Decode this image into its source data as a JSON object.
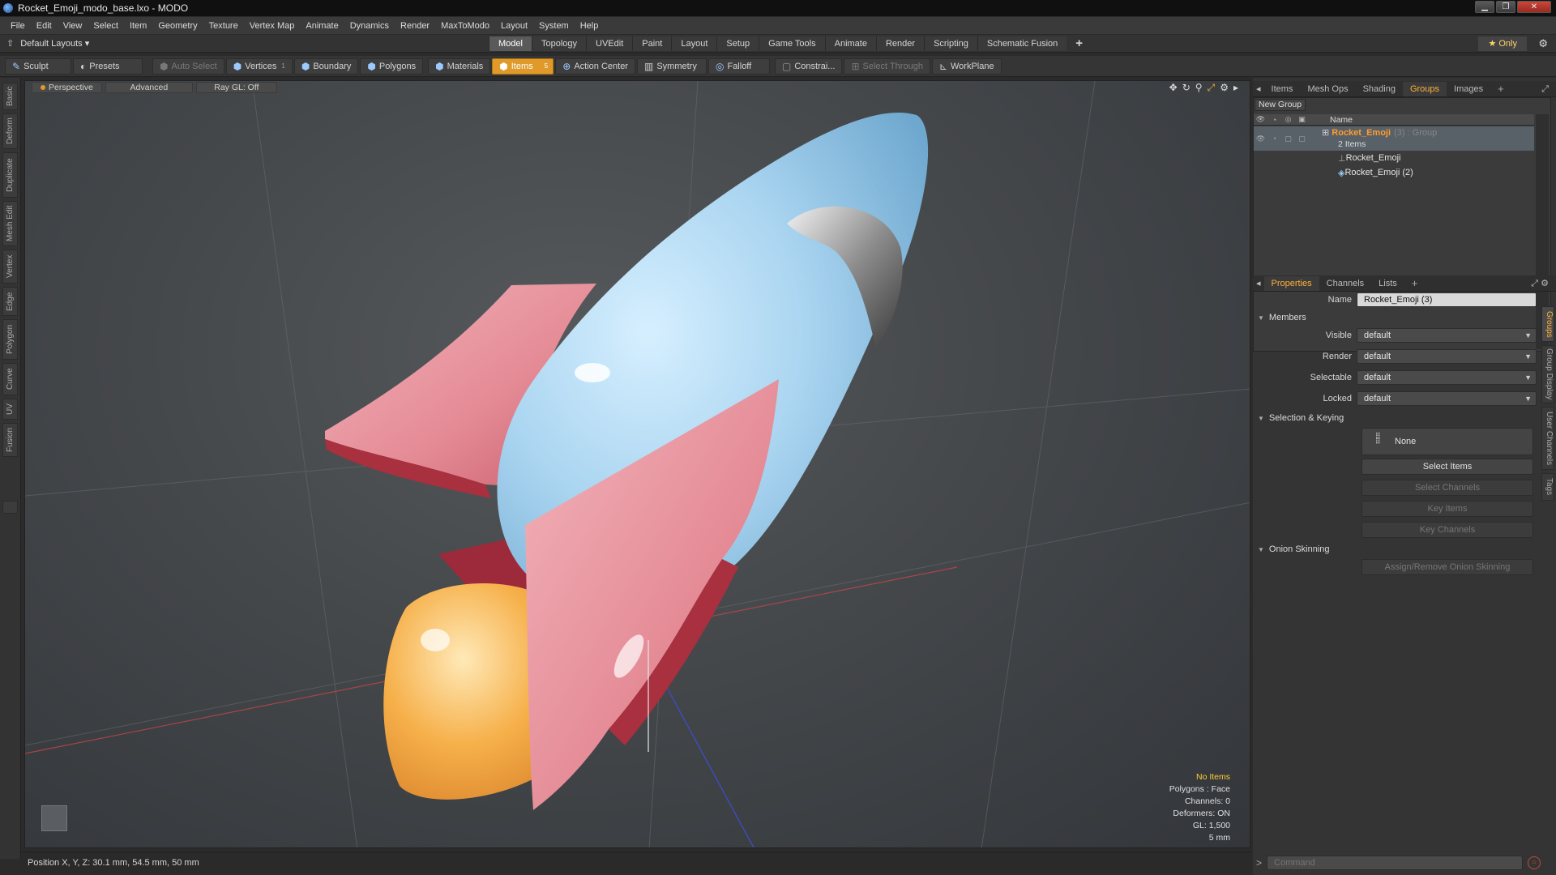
{
  "window": {
    "title": "Rocket_Emoji_modo_base.lxo - MODO",
    "minimize": "▁",
    "maximize": "❐",
    "close": "✕"
  },
  "menubar": [
    "File",
    "Edit",
    "View",
    "Select",
    "Item",
    "Geometry",
    "Texture",
    "Vertex Map",
    "Animate",
    "Dynamics",
    "Render",
    "MaxToModo",
    "Layout",
    "System",
    "Help"
  ],
  "layoutbar": {
    "layout_select": "Default Layouts ▾",
    "tabs": [
      "Model",
      "Topology",
      "UVEdit",
      "Paint",
      "Layout",
      "Setup",
      "Game Tools",
      "Animate",
      "Render",
      "Scripting",
      "Schematic Fusion"
    ],
    "active_tab": "Model",
    "plus": "+",
    "only": "★  Only"
  },
  "toolbar": {
    "sculpt": "Sculpt",
    "presets": "Presets",
    "auto_select": "Auto Select",
    "vertices": "Vertices",
    "vertices_count": "1",
    "boundary": "Boundary",
    "polygons": "Polygons",
    "materials": "Materials",
    "items": "Items",
    "items_count": "5",
    "action_center": "Action Center",
    "symmetry": "Symmetry",
    "falloff": "Falloff",
    "constrain": "Constrai...",
    "select_through": "Select Through",
    "workplane": "WorkPlane"
  },
  "left_tabs": [
    "Basic",
    "Deform",
    "Duplicate",
    "Mesh Edit",
    "Vertex",
    "Edge",
    "Polygon",
    "Curve",
    "UV",
    "Fusion"
  ],
  "viewport": {
    "view_mode": "Perspective",
    "advanced": "Advanced",
    "raygl": "Ray GL: Off",
    "info": {
      "no_items": "No Items",
      "polygons": "Polygons : Face",
      "channels": "Channels: 0",
      "deformers": "Deformers: ON",
      "gl": "GL: 1,500",
      "scale": "5 mm"
    }
  },
  "panel_tabs_top": [
    "Items",
    "Mesh Ops",
    "Shading",
    "Groups",
    "Images"
  ],
  "panel_tabs_top_active": "Groups",
  "groups": {
    "new_group": "New Group",
    "col_name": "Name",
    "group_name": "Rocket_Emoji",
    "group_suffix": "(3) : Group",
    "count": "2 Items",
    "members": [
      "Rocket_Emoji",
      "Rocket_Emoji (2)"
    ]
  },
  "panel_tabs_bottom": [
    "Properties",
    "Channels",
    "Lists"
  ],
  "panel_tabs_bottom_active": "Properties",
  "properties": {
    "name_label": "Name",
    "name_value": "Rocket_Emoji (3)",
    "members_section": "Members",
    "visible_label": "Visible",
    "visible_value": "default",
    "render_label": "Render",
    "render_value": "default",
    "selectable_label": "Selectable",
    "selectable_value": "default",
    "locked_label": "Locked",
    "locked_value": "default",
    "selection_section": "Selection & Keying",
    "none_btn": "None",
    "select_items": "Select Items",
    "select_channels": "Select Channels",
    "key_items": "Key Items",
    "key_channels": "Key Channels",
    "onion_section": "Onion Skinning",
    "onion_btn": "Assign/Remove Onion Skinning"
  },
  "side_tabs": [
    "Groups",
    "Group Display",
    "User Channels",
    "Tags"
  ],
  "statusbar": {
    "position": "Position X, Y, Z:   30.1 mm, 54.5 mm, 50 mm"
  },
  "command": {
    "prompt": ">",
    "placeholder": "Command"
  },
  "colors": {
    "accent": "#e09a2a",
    "selected_group": "#ff9d2e",
    "rocket_body": "#a9d4f0",
    "rocket_fins": "#e48a95",
    "flame": "#f6b04a"
  }
}
